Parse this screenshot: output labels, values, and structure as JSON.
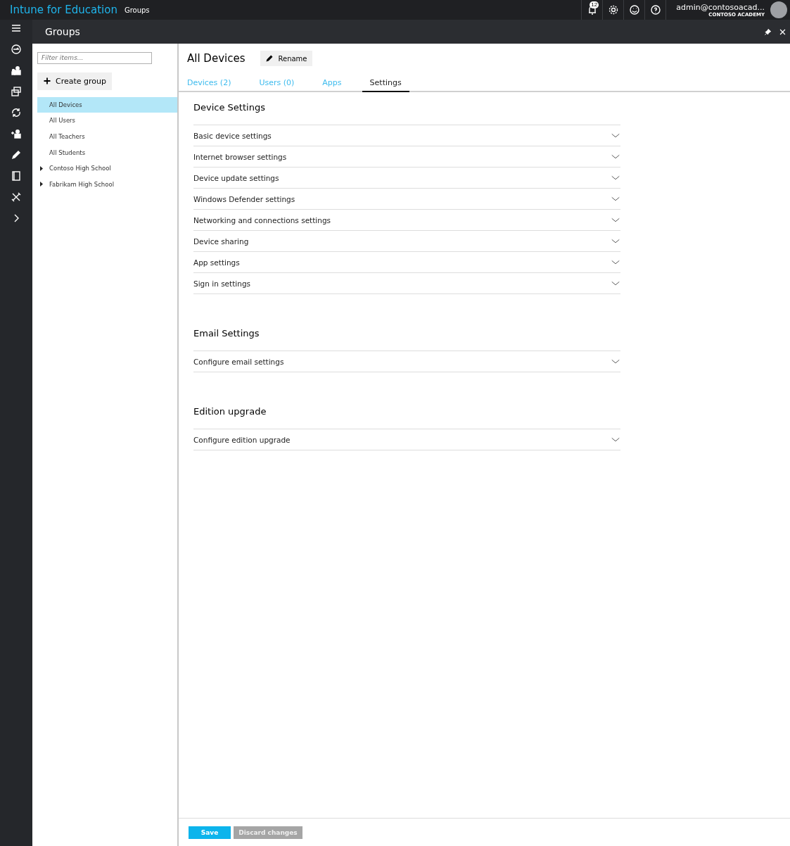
{
  "header": {
    "brand": "Intune for Education",
    "section": "Groups",
    "notification_count": "12",
    "user": "admin@contosoacad...",
    "org": "CONTOSO ACADEMY"
  },
  "blade": {
    "title": "Groups"
  },
  "nav_rail": [
    {
      "kind": "menu"
    },
    {
      "kind": "dashboard"
    },
    {
      "kind": "groups"
    },
    {
      "kind": "apps"
    },
    {
      "kind": "sync"
    },
    {
      "kind": "adduser"
    },
    {
      "kind": "edit"
    },
    {
      "kind": "notebook"
    },
    {
      "kind": "tools"
    },
    {
      "kind": "expand"
    }
  ],
  "groups_panel": {
    "filter": {
      "placeholder": "Filter items..."
    },
    "create_button": "Create group",
    "tree": [
      {
        "label": "All Devices",
        "selected": true
      },
      {
        "label": "All Users",
        "selected": false
      },
      {
        "label": "All Teachers",
        "selected": false
      },
      {
        "label": "All Students",
        "selected": false
      },
      {
        "label": "Contoso High School",
        "selected": false,
        "expanded": false
      },
      {
        "label": "Fabrikam High School",
        "selected": false,
        "expanded": false
      }
    ]
  },
  "detail": {
    "title": "All Devices",
    "rename_button": "Rename",
    "tabs": [
      {
        "label": "Devices (2)",
        "selected": false
      },
      {
        "label": "Users (0)",
        "selected": false
      },
      {
        "label": "Apps",
        "selected": false
      },
      {
        "label": "Settings",
        "selected": true
      }
    ],
    "sections": [
      {
        "title": "Device Settings",
        "items": [
          {
            "label": "Basic device settings",
            "expanded": false
          },
          {
            "label": "Internet browser settings",
            "expanded": false
          },
          {
            "label": "Device update settings",
            "expanded": false
          },
          {
            "label": "Windows Defender settings",
            "expanded": false
          },
          {
            "label": "Networking and connections settings",
            "expanded": false
          },
          {
            "label": "Device sharing",
            "expanded": false
          },
          {
            "label": "App settings",
            "expanded": false
          },
          {
            "label": "Sign in settings",
            "expanded": false
          }
        ]
      },
      {
        "title": "Email Settings",
        "items": [
          {
            "label": "Configure email settings",
            "expanded": false
          }
        ]
      },
      {
        "title": "Edition upgrade",
        "items": [
          {
            "label": "Configure edition upgrade",
            "expanded": false
          }
        ]
      }
    ],
    "save_button": "Save",
    "discard_button": {
      "label": "Discard changes",
      "disabled": true
    }
  }
}
